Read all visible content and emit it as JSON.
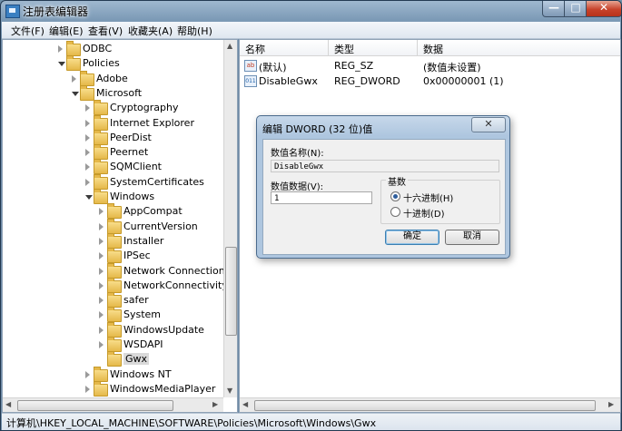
{
  "window": {
    "title": "注册表编辑器",
    "controls": {
      "minimize": "—",
      "maximize": "□",
      "close": "✕"
    }
  },
  "menu": [
    "文件(F)",
    "编辑(E)",
    "查看(V)",
    "收藏夹(A)",
    "帮助(H)"
  ],
  "tree": [
    {
      "label": "ODBC",
      "expanded": false
    },
    {
      "label": "Policies",
      "expanded": true
    },
    {
      "label": "Adobe",
      "expanded": false
    },
    {
      "label": "Microsoft",
      "expanded": true
    },
    {
      "label": "Cryptography",
      "expanded": false
    },
    {
      "label": "Internet Explorer",
      "expanded": false
    },
    {
      "label": "PeerDist",
      "expanded": false
    },
    {
      "label": "Peernet",
      "expanded": false
    },
    {
      "label": "SQMClient",
      "expanded": false
    },
    {
      "label": "SystemCertificates",
      "expanded": false
    },
    {
      "label": "Windows",
      "expanded": true
    },
    {
      "label": "AppCompat",
      "expanded": false
    },
    {
      "label": "CurrentVersion",
      "expanded": false
    },
    {
      "label": "Installer",
      "expanded": false
    },
    {
      "label": "IPSec",
      "expanded": false
    },
    {
      "label": "Network Connections",
      "expanded": false
    },
    {
      "label": "NetworkConnectivitySta",
      "expanded": false
    },
    {
      "label": "safer",
      "expanded": false
    },
    {
      "label": "System",
      "expanded": false
    },
    {
      "label": "WindowsUpdate",
      "expanded": false
    },
    {
      "label": "WSDAPI",
      "expanded": false
    },
    {
      "label": "Gwx",
      "selected": true
    },
    {
      "label": "Windows NT",
      "expanded": false
    },
    {
      "label": "WindowsMediaPlayer",
      "expanded": false
    }
  ],
  "list": {
    "headers": {
      "name": "名称",
      "type": "类型",
      "data": "数据"
    },
    "rows": [
      {
        "icon": "ab",
        "name": "(默认)",
        "type": "REG_SZ",
        "data": "(数值未设置)"
      },
      {
        "icon": "011",
        "name": "DisableGwx",
        "type": "REG_DWORD",
        "data": "0x00000001 (1)"
      }
    ]
  },
  "dialog": {
    "title": "编辑 DWORD (32 位)值",
    "close": "✕",
    "name_label": "数值名称(N):",
    "name_value": "DisableGwx",
    "data_label": "数值数据(V):",
    "data_value": "1",
    "base_label": "基数",
    "hex_label": "十六进制(H)",
    "dec_label": "十进制(D)",
    "selected_base": "hex",
    "ok": "确定",
    "cancel": "取消"
  },
  "status": "计算机\\HKEY_LOCAL_MACHINE\\SOFTWARE\\Policies\\Microsoft\\Windows\\Gwx"
}
